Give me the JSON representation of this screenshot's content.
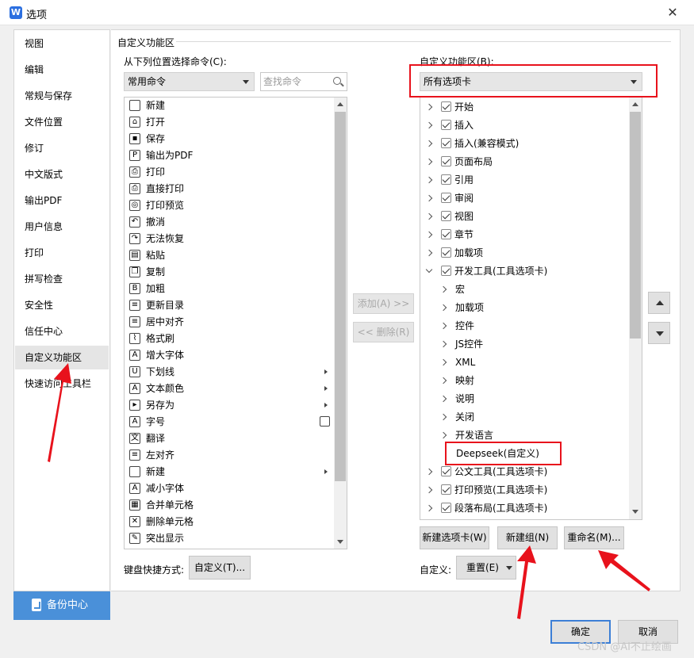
{
  "window": {
    "title": "选项",
    "app_icon": "W",
    "close": "✕"
  },
  "sidebar": {
    "items": [
      "视图",
      "编辑",
      "常规与保存",
      "文件位置",
      "修订",
      "中文版式",
      "输出PDF",
      "用户信息",
      "打印",
      "拼写检查",
      "安全性",
      "信任中心",
      "自定义功能区",
      "快速访问工具栏"
    ],
    "active": "自定义功能区",
    "backup": "备份中心"
  },
  "panel": {
    "title": "自定义功能区",
    "left_label": "从下列位置选择命令(C):",
    "left_dropdown": "常用命令",
    "search_placeholder": "查找命令",
    "right_label": "自定义功能区(B):",
    "right_dropdown": "所有选项卡"
  },
  "commands": [
    {
      "label": "新建",
      "icon": "new-doc-icon",
      "glyph": "",
      "sub": false
    },
    {
      "label": "打开",
      "icon": "open-folder-icon",
      "glyph": "⌂",
      "sub": false
    },
    {
      "label": "保存",
      "icon": "save-icon",
      "glyph": "▪",
      "sub": false
    },
    {
      "label": "输出为PDF",
      "icon": "pdf-icon",
      "glyph": "P",
      "sub": false
    },
    {
      "label": "打印",
      "icon": "print-icon",
      "glyph": "⎙",
      "sub": false
    },
    {
      "label": "直接打印",
      "icon": "direct-print-icon",
      "glyph": "⎙",
      "sub": false
    },
    {
      "label": "打印预览",
      "icon": "print-preview-icon",
      "glyph": "◎",
      "sub": false
    },
    {
      "label": "撤消",
      "icon": "undo-icon",
      "glyph": "↶",
      "sub": false
    },
    {
      "label": "无法恢复",
      "icon": "redo-icon",
      "glyph": "↷",
      "sub": false
    },
    {
      "label": "粘贴",
      "icon": "paste-icon",
      "glyph": "▤",
      "sub": false
    },
    {
      "label": "复制",
      "icon": "copy-icon",
      "glyph": "❐",
      "sub": false
    },
    {
      "label": "加粗",
      "icon": "bold-icon",
      "glyph": "B",
      "sub": false
    },
    {
      "label": "更新目录",
      "icon": "update-toc-icon",
      "glyph": "≡",
      "sub": false
    },
    {
      "label": "居中对齐",
      "icon": "align-center-icon",
      "glyph": "≡",
      "sub": false
    },
    {
      "label": "格式刷",
      "icon": "format-painter-icon",
      "glyph": "⌇",
      "sub": false
    },
    {
      "label": "增大字体",
      "icon": "grow-font-icon",
      "glyph": "A",
      "sub": false
    },
    {
      "label": "下划线",
      "icon": "underline-icon",
      "glyph": "U",
      "sub": true
    },
    {
      "label": "文本颜色",
      "icon": "font-color-icon",
      "glyph": "A",
      "sub": true
    },
    {
      "label": "另存为",
      "icon": "save-as-icon",
      "glyph": "▸",
      "sub": true
    },
    {
      "label": "字号",
      "icon": "font-size-icon",
      "glyph": "A",
      "sub": false,
      "combo": true
    },
    {
      "label": "翻译",
      "icon": "translate-icon",
      "glyph": "文",
      "sub": false
    },
    {
      "label": "左对齐",
      "icon": "align-left-icon",
      "glyph": "≡",
      "sub": false
    },
    {
      "label": "新建",
      "icon": "new-doc-icon",
      "glyph": "",
      "sub": true
    },
    {
      "label": "减小字体",
      "icon": "shrink-font-icon",
      "glyph": "A",
      "sub": false
    },
    {
      "label": "合并单元格",
      "icon": "merge-cells-icon",
      "glyph": "▦",
      "sub": false
    },
    {
      "label": "删除单元格",
      "icon": "delete-cells-icon",
      "glyph": "✕",
      "sub": false
    },
    {
      "label": "突出显示",
      "icon": "highlight-icon",
      "glyph": "✎",
      "sub": false
    }
  ],
  "middle_buttons": {
    "add": "添加(A) >>",
    "remove": "<< 删除(R)"
  },
  "tree": [
    {
      "label": "开始",
      "level": 0,
      "checked": true,
      "expanded": false
    },
    {
      "label": "插入",
      "level": 0,
      "checked": true,
      "expanded": false
    },
    {
      "label": "插入(兼容模式)",
      "level": 0,
      "checked": true,
      "expanded": false
    },
    {
      "label": "页面布局",
      "level": 0,
      "checked": true,
      "expanded": false
    },
    {
      "label": "引用",
      "level": 0,
      "checked": true,
      "expanded": false
    },
    {
      "label": "审阅",
      "level": 0,
      "checked": true,
      "expanded": false
    },
    {
      "label": "视图",
      "level": 0,
      "checked": true,
      "expanded": false
    },
    {
      "label": "章节",
      "level": 0,
      "checked": true,
      "expanded": false
    },
    {
      "label": "加载项",
      "level": 0,
      "checked": true,
      "expanded": false
    },
    {
      "label": "开发工具(工具选项卡)",
      "level": 0,
      "checked": true,
      "expanded": true,
      "selected": true
    },
    {
      "label": "宏",
      "level": 1
    },
    {
      "label": "加载项",
      "level": 1
    },
    {
      "label": "控件",
      "level": 1
    },
    {
      "label": "JS控件",
      "level": 1
    },
    {
      "label": "XML",
      "level": 1
    },
    {
      "label": "映射",
      "level": 1
    },
    {
      "label": "说明",
      "level": 1
    },
    {
      "label": "关闭",
      "level": 1
    },
    {
      "label": "开发语言",
      "level": 1
    },
    {
      "label": "Deepseek(自定义)",
      "level": 1,
      "leaf": true
    },
    {
      "label": "公文工具(工具选项卡)",
      "level": 0,
      "checked": true,
      "expanded": false
    },
    {
      "label": "打印预览(工具选项卡)",
      "level": 0,
      "checked": true,
      "expanded": false
    },
    {
      "label": "段落布局(工具选项卡)",
      "level": 0,
      "checked": true,
      "expanded": false
    }
  ],
  "bottom": {
    "new_tab": "新建选项卡(W)",
    "new_group": "新建组(N)",
    "rename": "重命名(M)...",
    "keyboard_label": "键盘快捷方式:",
    "customize_btn": "自定义(T)...",
    "custom_label": "自定义:",
    "reset": "重置(E)",
    "ok": "确定",
    "cancel": "取消"
  },
  "watermark": "CSDN @AI不止绘画",
  "colors": {
    "highlight_red": "#e8121c",
    "accent_blue": "#4a90d9"
  }
}
